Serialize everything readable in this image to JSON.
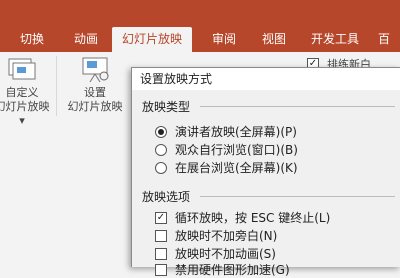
{
  "ribbon": {
    "tabs": [
      {
        "label": "切换"
      },
      {
        "label": "动画"
      },
      {
        "label": "幻灯片放映"
      },
      {
        "label": "审阅"
      },
      {
        "label": "视图"
      },
      {
        "label": "开发工具"
      },
      {
        "label": "百"
      }
    ],
    "groups": {
      "custom": {
        "line1": "自定义",
        "line2": "幻灯片放映"
      },
      "setup": {
        "line1": "设置",
        "line2": "幻灯片放映"
      },
      "partial_check_label": "排练新白"
    }
  },
  "dialog": {
    "title": "设置放映方式",
    "show_type": {
      "title": "放映类型",
      "options": [
        {
          "label": "演讲者放映(全屏幕)(P)",
          "selected": true
        },
        {
          "label": "观众自行浏览(窗口)(B)",
          "selected": false
        },
        {
          "label": "在展台浏览(全屏幕)(K)",
          "selected": false
        }
      ]
    },
    "show_options": {
      "title": "放映选项",
      "options": [
        {
          "label": "循环放映，按 ESC 键终止(L)",
          "checked": true
        },
        {
          "label": "放映时不加旁白(N)",
          "checked": false
        },
        {
          "label": "放映时不加动画(S)",
          "checked": false
        },
        {
          "label": "禁用硬件图形加速(G)",
          "checked": false
        }
      ]
    }
  },
  "colors": {
    "accent": "#b7472a"
  }
}
